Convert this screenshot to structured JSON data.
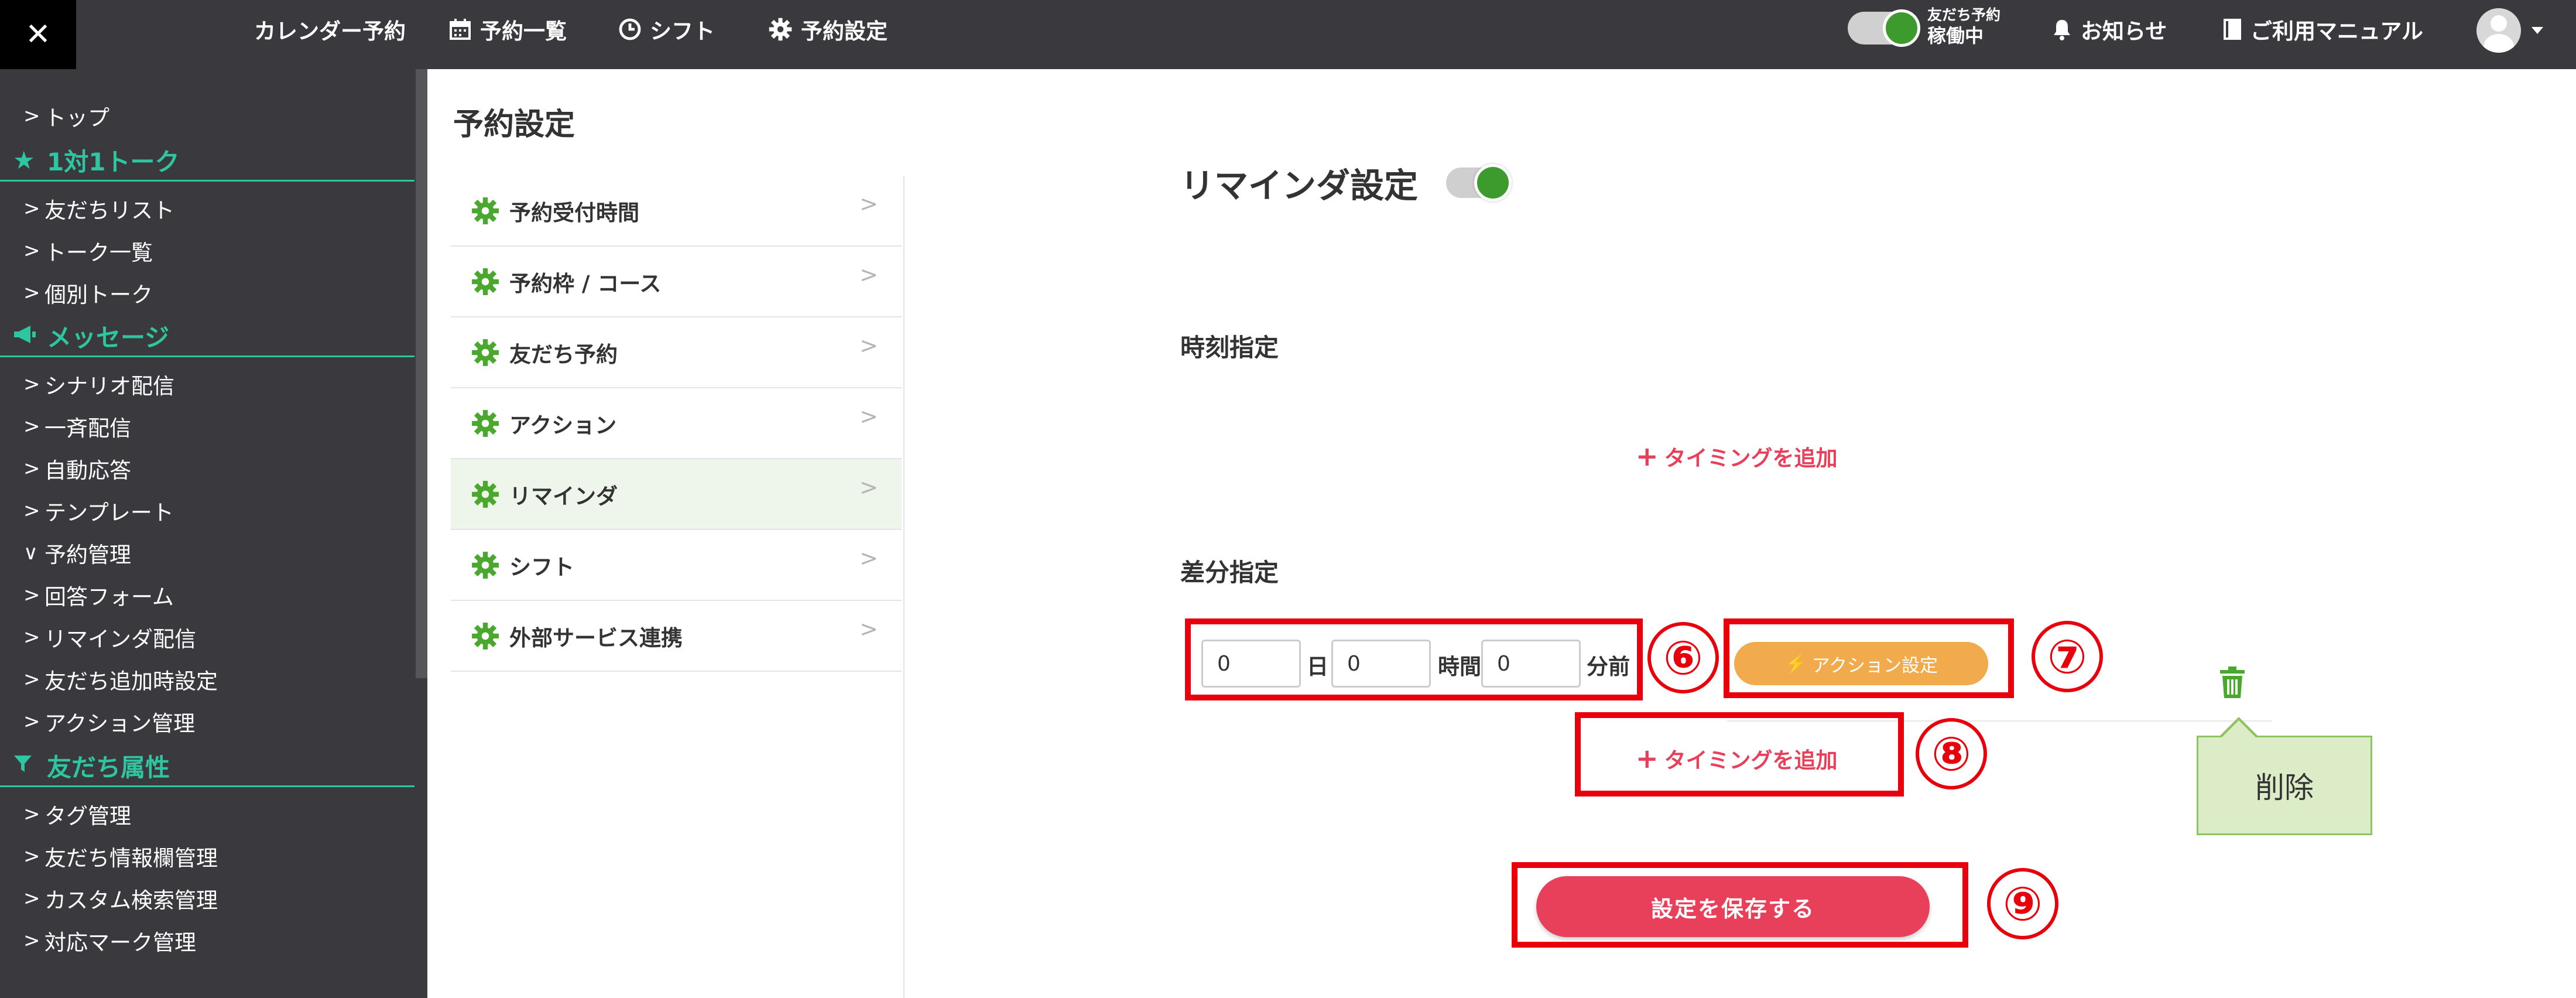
{
  "topbar": {
    "close_glyph": "✕",
    "nav": [
      {
        "label": "カレンダー予約",
        "icon": ""
      },
      {
        "label": "予約一覧",
        "icon": "calendar-icon"
      },
      {
        "label": "シフト",
        "icon": "clock-icon"
      },
      {
        "label": "予約設定",
        "icon": "gear-icon"
      }
    ],
    "status_line1": "友だち予約",
    "status_line2": "稼働中",
    "notice_label": "お知らせ",
    "manual_label": "ご利用マニュアル"
  },
  "sidebar": {
    "items": [
      {
        "type": "item",
        "label": "トップ",
        "chev": ">"
      },
      {
        "type": "head",
        "label": "1対1トーク",
        "icon": "star-icon"
      },
      {
        "type": "item",
        "label": "友だちリスト",
        "chev": ">"
      },
      {
        "type": "item",
        "label": "トーク一覧",
        "chev": ">"
      },
      {
        "type": "item",
        "label": "個別トーク",
        "chev": ">"
      },
      {
        "type": "head",
        "label": "メッセージ",
        "icon": "megaphone-icon"
      },
      {
        "type": "item",
        "label": "シナリオ配信",
        "chev": ">"
      },
      {
        "type": "item",
        "label": "一斉配信",
        "chev": ">"
      },
      {
        "type": "item",
        "label": "自動応答",
        "chev": ">"
      },
      {
        "type": "item",
        "label": "テンプレート",
        "chev": ">"
      },
      {
        "type": "item",
        "label": "予約管理",
        "chev": "∨"
      },
      {
        "type": "item",
        "label": "回答フォーム",
        "chev": ">"
      },
      {
        "type": "item",
        "label": "リマインダ配信",
        "chev": ">"
      },
      {
        "type": "item",
        "label": "友だち追加時設定",
        "chev": ">"
      },
      {
        "type": "item",
        "label": "アクション管理",
        "chev": ">"
      },
      {
        "type": "head",
        "label": "友だち属性",
        "icon": "filter-icon"
      },
      {
        "type": "item",
        "label": "タグ管理",
        "chev": ">"
      },
      {
        "type": "item",
        "label": "友だち情報欄管理",
        "chev": ">"
      },
      {
        "type": "item",
        "label": "カスタム検索管理",
        "chev": ">"
      },
      {
        "type": "item",
        "label": "対応マーク管理",
        "chev": ">"
      }
    ]
  },
  "page": {
    "title": "予約設定"
  },
  "subnav": {
    "items": [
      {
        "label": "予約受付時間",
        "active": false
      },
      {
        "label": "予約枠 / コース",
        "active": false
      },
      {
        "label": "友だち予約",
        "active": false
      },
      {
        "label": "アクション",
        "active": false
      },
      {
        "label": "リマインダ",
        "active": true
      },
      {
        "label": "シフト",
        "active": false
      },
      {
        "label": "外部サービス連携",
        "active": false
      }
    ],
    "arrow": ">"
  },
  "reminder": {
    "title": "リマインダ設定",
    "toggle_on": true,
    "time_label": "時刻指定",
    "add_timing_label": "タイミングを追加",
    "diff_label": "差分指定",
    "days_value": "0",
    "days_unit": "日",
    "hours_value": "0",
    "hours_unit": "時間",
    "minutes_value": "0",
    "minutes_unit": "分前",
    "action_button": "アクション設定",
    "add_timing_label_2": "タイミングを追加",
    "delete_callout": "削除",
    "save_button": "設定を保存する"
  },
  "annotations": {
    "b6": "⑥",
    "b7": "⑦",
    "b8": "⑧",
    "b9": "⑨",
    "color": "#e8000c"
  },
  "colors": {
    "topbar_bg": "#3a3a3e",
    "accent_teal": "#2ec6a0",
    "primary_red": "#e8405a",
    "action_orange": "#f2ab4c",
    "gear_green": "#4aa82e",
    "toggle_green": "#3c9b2c"
  }
}
